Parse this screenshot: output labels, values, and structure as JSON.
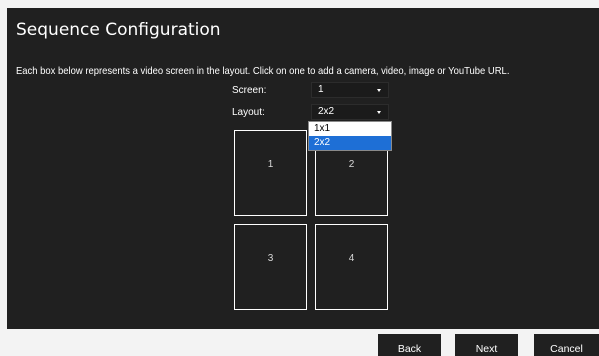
{
  "dialog": {
    "title": "Sequence Configuration",
    "description": "Each box below represents a video screen in the layout. Click on one to add a camera, video, image or YouTube URL."
  },
  "form": {
    "screen": {
      "label": "Screen:",
      "value": "1"
    },
    "layout": {
      "label": "Layout:",
      "value": "2x2",
      "options": [
        "1x1",
        "2x2"
      ],
      "highlighted": "2x2"
    }
  },
  "layout_boxes": [
    "1",
    "2",
    "3",
    "4"
  ],
  "buttons": {
    "back": "Back",
    "next": "Next",
    "cancel": "Cancel"
  },
  "colors": {
    "panel": "#202020",
    "highlight": "#1e6fd6",
    "footer": "#f3f3f3"
  }
}
